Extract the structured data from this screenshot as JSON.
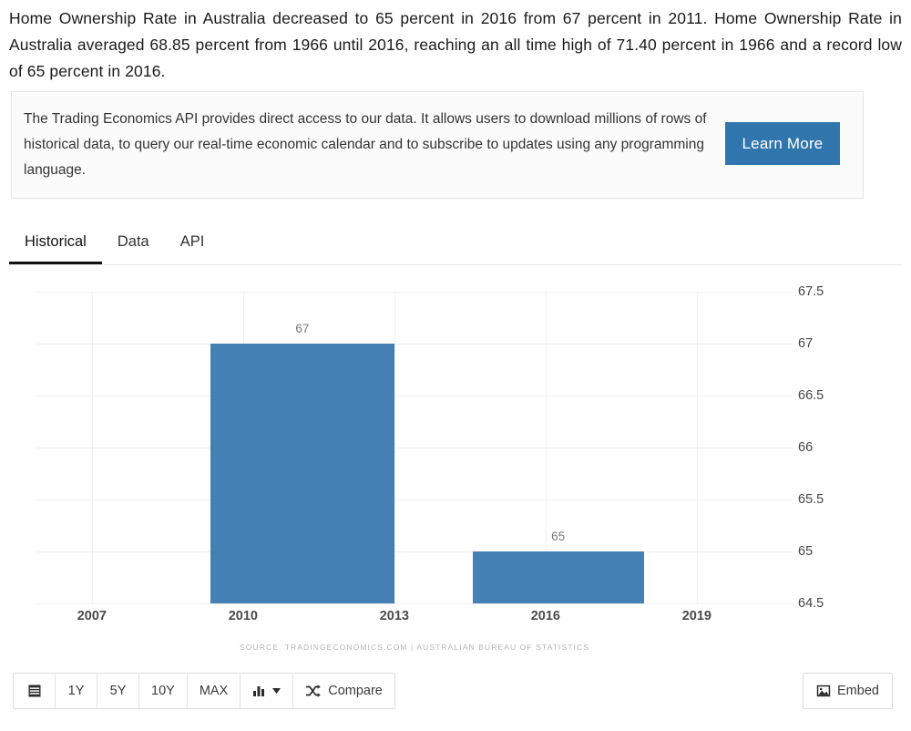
{
  "intro": {
    "text": "Home Ownership Rate in Australia decreased to 65 percent in 2016 from 67 percent in 2011. Home Ownership Rate in Australia averaged 68.85 percent from 1966 until 2016, reaching an all time high of 71.40 percent in 1966 and a record low of 65 percent in 2016."
  },
  "api_box": {
    "text": "The Trading Economics API provides direct access to our data. It allows users to download millions of rows of historical data, to query our real-time economic calendar and to subscribe to updates using any programming language.",
    "button_label": "Learn More",
    "button_color": "#3076ac"
  },
  "tabs": [
    {
      "label": "Historical",
      "active": true
    },
    {
      "label": "Data",
      "active": false
    },
    {
      "label": "API",
      "active": false
    }
  ],
  "toolbar": {
    "calendar_icon": "calendar-icon",
    "ranges": [
      "1Y",
      "5Y",
      "10Y",
      "MAX"
    ],
    "chart_type_icon": "bar-chart-icon",
    "chart_type_caret": "chevron-down-icon",
    "compare_icon": "shuffle-icon",
    "compare_label": "Compare",
    "embed_icon": "image-icon",
    "embed_label": "Embed"
  },
  "chart_data": {
    "type": "bar",
    "title": "",
    "xlabel": "",
    "ylabel": "",
    "categories": [
      "2011",
      "2016"
    ],
    "values": [
      67,
      65
    ],
    "bar_labels": [
      "67",
      "65"
    ],
    "bar_color": "#4580b4",
    "ylim": [
      64.5,
      67.5
    ],
    "yticks": [
      "67.5",
      "67",
      "66.5",
      "66",
      "65.5",
      "65",
      "64.5"
    ],
    "ytick_values": [
      67.5,
      67,
      66.5,
      66,
      65.5,
      65,
      64.5
    ],
    "xticks": [
      "2007",
      "2010",
      "2013",
      "2016",
      "2019"
    ],
    "xtick_values": [
      2007,
      2010,
      2013,
      2016,
      2019
    ],
    "xlim": [
      2005.9,
      2020.9
    ],
    "bar_spans": [
      [
        2009.35,
        2013.0
      ],
      [
        2014.55,
        2017.95
      ]
    ],
    "grid": true,
    "legend": "none",
    "source": "SOURCE: TRADINGECONOMICS.COM  |  AUSTRALIAN BUREAU OF STATISTICS"
  }
}
